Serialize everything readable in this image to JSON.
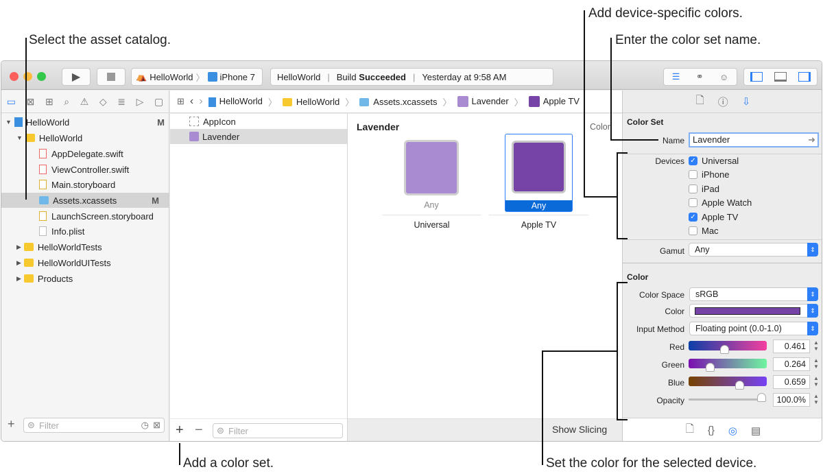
{
  "annotations": {
    "select_catalog": "Select the asset catalog.",
    "device_colors": "Add device-specific colors.",
    "color_set_name": "Enter the color set name.",
    "add_color_set": "Add a color set.",
    "set_color": "Set the color for the selected device."
  },
  "toolbar": {
    "scheme": "HelloWorld",
    "device": "iPhone 7",
    "status_project": "HelloWorld",
    "status_build": "Build",
    "status_result": "Succeeded",
    "status_time": "Yesterday at 9:58 AM"
  },
  "breadcrumb": [
    "HelloWorld",
    "HelloWorld",
    "Assets.xcassets",
    "Lavender",
    "Apple TV"
  ],
  "navigator": {
    "items": [
      {
        "label": "HelloWorld",
        "badge": "M"
      },
      {
        "label": "HelloWorld"
      },
      {
        "label": "AppDelegate.swift"
      },
      {
        "label": "ViewController.swift"
      },
      {
        "label": "Main.storyboard"
      },
      {
        "label": "Assets.xcassets",
        "badge": "M"
      },
      {
        "label": "LaunchScreen.storyboard"
      },
      {
        "label": "Info.plist"
      },
      {
        "label": "HelloWorldTests"
      },
      {
        "label": "HelloWorldUITests"
      },
      {
        "label": "Products"
      }
    ],
    "filter_placeholder": "Filter"
  },
  "assets": {
    "items": [
      "AppIcon",
      "Lavender"
    ],
    "filter_placeholder": "Filter",
    "add": "+",
    "remove": "−"
  },
  "canvas": {
    "title": "Lavender",
    "side_label": "Color",
    "wells": [
      {
        "label": "Any",
        "group": "Universal",
        "color": "#a98bd2"
      },
      {
        "label": "Any",
        "group": "Apple TV",
        "color": "#7644a6"
      }
    ],
    "show_slicing": "Show Slicing"
  },
  "inspector": {
    "color_set_header": "Color Set",
    "name_label": "Name",
    "name_value": "Lavender",
    "devices_label": "Devices",
    "devices": [
      {
        "label": "Universal",
        "checked": true
      },
      {
        "label": "iPhone",
        "checked": false
      },
      {
        "label": "iPad",
        "checked": false
      },
      {
        "label": "Apple Watch",
        "checked": false
      },
      {
        "label": "Apple TV",
        "checked": true
      },
      {
        "label": "Mac",
        "checked": false
      }
    ],
    "gamut_label": "Gamut",
    "gamut_value": "Any",
    "color_header": "Color",
    "color_space_label": "Color Space",
    "color_space_value": "sRGB",
    "color_label": "Color",
    "swatch": "#7644a6",
    "input_method_label": "Input Method",
    "input_method_value": "Floating point (0.0-1.0)",
    "red_label": "Red",
    "red": "0.461",
    "green_label": "Green",
    "green": "0.264",
    "blue_label": "Blue",
    "blue": "0.659",
    "opacity_label": "Opacity",
    "opacity": "100.0%"
  }
}
